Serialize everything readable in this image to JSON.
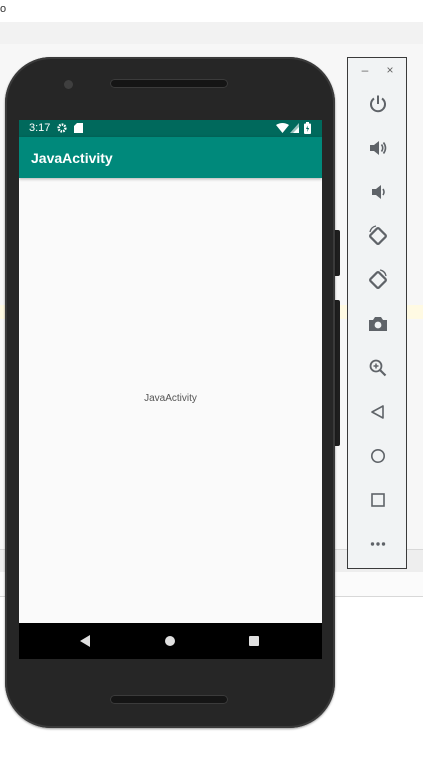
{
  "ide": {
    "top_fragment": "o"
  },
  "device": {
    "status_bar": {
      "time": "3:17"
    },
    "app_bar": {
      "title": "JavaActivity"
    },
    "content": {
      "center_text": "JavaActivity"
    }
  },
  "emulator_controls": {
    "window_buttons": {
      "minimize": "–",
      "close": "×"
    },
    "buttons": [
      "power",
      "volume-up",
      "volume-down",
      "rotate-left",
      "rotate-right",
      "screenshot",
      "zoom",
      "back",
      "home",
      "overview",
      "more"
    ]
  }
}
